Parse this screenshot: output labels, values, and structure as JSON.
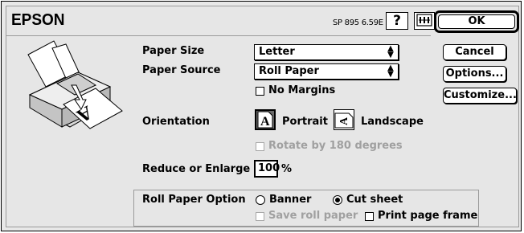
{
  "header": {
    "brand": "EPSON",
    "version": "SP 895 6.59E",
    "help_label": "?"
  },
  "buttons": {
    "ok": "OK",
    "cancel": "Cancel",
    "options": "Options...",
    "customize": "Customize..."
  },
  "paper_size": {
    "label": "Paper Size",
    "value": "Letter"
  },
  "paper_source": {
    "label": "Paper Source",
    "value": "Roll Paper"
  },
  "no_margins": {
    "label": "No Margins",
    "checked": false
  },
  "orientation": {
    "label": "Orientation",
    "portrait_label": "Portrait",
    "landscape_label": "Landscape",
    "selected": "Portrait"
  },
  "rotate": {
    "label": "Rotate by 180 degrees",
    "enabled": false,
    "checked": false
  },
  "reduce_enlarge": {
    "label": "Reduce or Enlarge",
    "value": "100",
    "unit": "%"
  },
  "roll_paper_option": {
    "label": "Roll Paper Option",
    "banner_label": "Banner",
    "cut_sheet_label": "Cut sheet",
    "selected": "Cut sheet",
    "save_roll_label": "Save roll paper",
    "print_frame_label": "Print page frame"
  },
  "colors": {
    "dialog_bg": "#e6e6e6",
    "disabled": "#a0a0a0"
  },
  "icons": [
    "printer-illustration-icon",
    "help-icon",
    "utility-icon",
    "portrait-icon",
    "landscape-icon",
    "popup-arrows-icon"
  ]
}
